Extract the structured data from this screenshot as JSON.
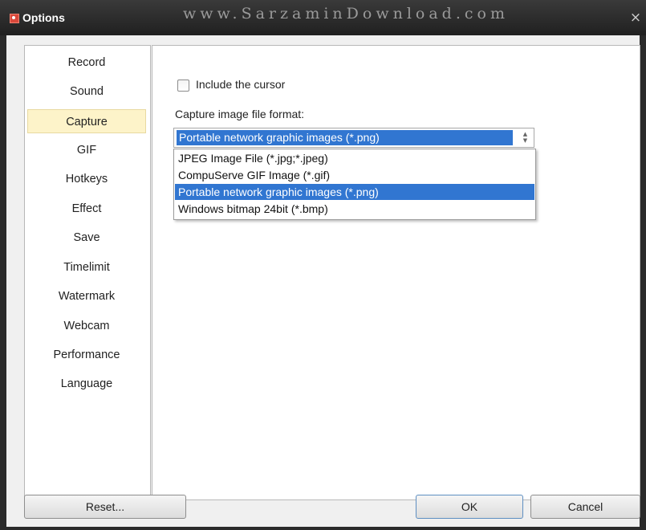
{
  "window": {
    "title": "Options",
    "watermark": "www.SarzaminDownload.com",
    "close_glyph": "×"
  },
  "nav": {
    "items": [
      {
        "label": "Record"
      },
      {
        "label": "Sound"
      },
      {
        "label": "Capture",
        "selected": true
      },
      {
        "label": "GIF"
      },
      {
        "label": "Hotkeys"
      },
      {
        "label": "Effect"
      },
      {
        "label": "Save"
      },
      {
        "label": "Timelimit"
      },
      {
        "label": "Watermark"
      },
      {
        "label": "Webcam"
      },
      {
        "label": "Performance"
      },
      {
        "label": "Language"
      }
    ]
  },
  "capture": {
    "include_cursor_label": "Include the cursor",
    "include_cursor_checked": false,
    "format_label": "Capture image file format:",
    "format_value": "Portable network graphic images (*.png)",
    "format_options": [
      "JPEG Image File (*.jpg;*.jpeg)",
      "CompuServe GIF Image (*.gif)",
      "Portable network graphic images (*.png)",
      "Windows bitmap 24bit (*.bmp)"
    ],
    "selected_option_index": 2
  },
  "buttons": {
    "reset": "Reset...",
    "ok": "OK",
    "cancel": "Cancel"
  },
  "icons": {
    "app": "options-app-icon",
    "close": "close-icon",
    "spin": "spin-arrows-icon"
  },
  "colors": {
    "selection": "#3176d1",
    "nav_selected": "#fdf3c9"
  }
}
